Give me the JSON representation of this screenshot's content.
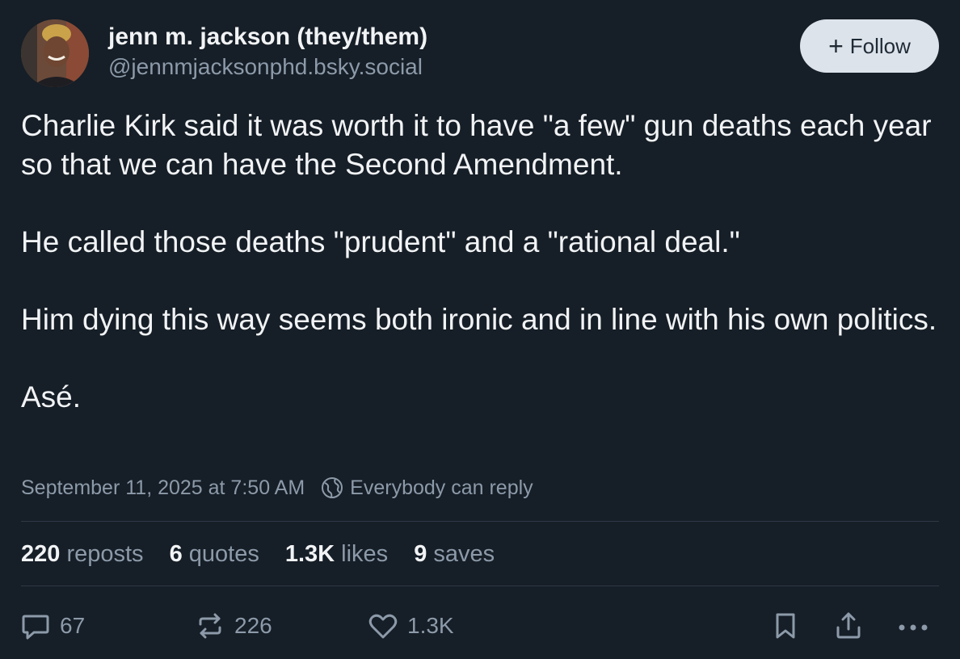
{
  "author": {
    "display_name": "jenn m. jackson (they/them)",
    "handle": "@jennmjacksonphd.bsky.social"
  },
  "follow_button": {
    "icon": "plus-icon",
    "label": "Follow"
  },
  "post": {
    "paragraphs": [
      "Charlie Kirk said it was worth it to have \"a few\" gun deaths each year so that we can have the Second Amendment.",
      "He called those deaths \"prudent\" and a \"rational deal.\"",
      "Him dying this way seems both ironic and in line with his own politics.",
      "Asé."
    ],
    "timestamp": "September 11, 2025 at 7:50 AM",
    "reply_setting": {
      "icon": "globe-icon",
      "label": "Everybody can reply"
    }
  },
  "stats": [
    {
      "count": "220",
      "label": "reposts"
    },
    {
      "count": "6",
      "label": "quotes"
    },
    {
      "count": "1.3K",
      "label": "likes"
    },
    {
      "count": "9",
      "label": "saves"
    }
  ],
  "actions": {
    "reply": {
      "icon": "reply-bubble-icon",
      "count": "67"
    },
    "repost": {
      "icon": "repost-icon",
      "count": "226"
    },
    "like": {
      "icon": "heart-icon",
      "count": "1.3K"
    },
    "bookmark": {
      "icon": "bookmark-icon"
    },
    "share": {
      "icon": "share-icon"
    },
    "more": {
      "icon": "more-dots-icon"
    }
  },
  "colors": {
    "background": "#161e27",
    "text_primary": "#f1f3f5",
    "text_secondary": "#8c9aa9",
    "follow_button_bg": "#dde3ea",
    "divider": "#2e3a47"
  }
}
